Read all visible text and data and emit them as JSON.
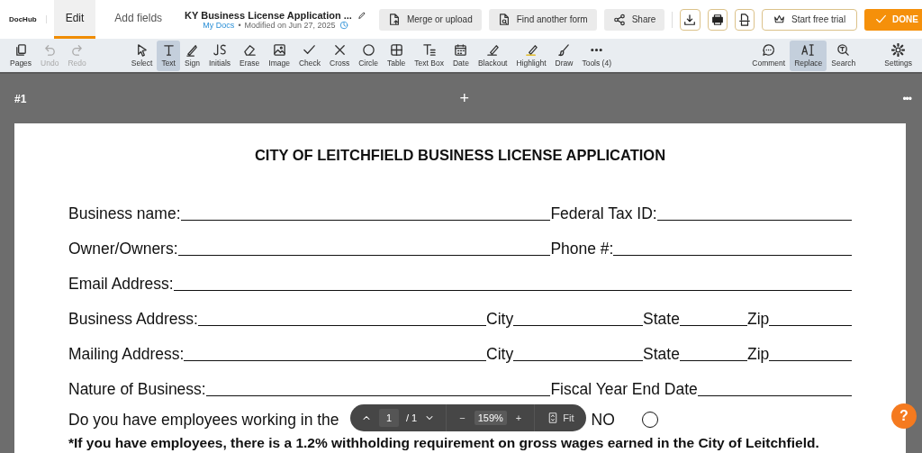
{
  "topbar": {
    "logo": "DocHub",
    "tabs": [
      {
        "label": "Edit",
        "selected": true
      },
      {
        "label": "Add fields",
        "selected": false
      }
    ],
    "document": {
      "title": "KY Business License Application ...",
      "location": "My Docs",
      "separator": "•",
      "modified": "Modified on Jun 27, 2025"
    },
    "buttons": [
      {
        "label": "Merge or upload"
      },
      {
        "label": "Find another form"
      },
      {
        "label": "Share"
      }
    ],
    "trial_button": "Start free trial",
    "done_button": "DONE"
  },
  "toolbar": {
    "groups": [
      [
        {
          "label": "Pages",
          "disabled": false,
          "selected": false
        },
        {
          "label": "Undo",
          "disabled": true,
          "selected": false
        },
        {
          "label": "Redo",
          "disabled": true,
          "selected": false
        }
      ],
      [
        {
          "label": "Select",
          "disabled": false,
          "selected": false
        },
        {
          "label": "Text",
          "disabled": false,
          "selected": true
        },
        {
          "label": "Sign",
          "disabled": false,
          "selected": false
        },
        {
          "label": "Initials",
          "disabled": false,
          "selected": false
        },
        {
          "label": "Erase",
          "disabled": false,
          "selected": false
        },
        {
          "label": "Image",
          "disabled": false,
          "selected": false
        },
        {
          "label": "Check",
          "disabled": false,
          "selected": false
        },
        {
          "label": "Cross",
          "disabled": false,
          "selected": false
        },
        {
          "label": "Circle",
          "disabled": false,
          "selected": false
        },
        {
          "label": "Table",
          "disabled": false,
          "selected": false
        },
        {
          "label": "Text Box",
          "disabled": false,
          "selected": false
        },
        {
          "label": "Date",
          "disabled": false,
          "selected": false
        },
        {
          "label": "Blackout",
          "disabled": false,
          "selected": false
        },
        {
          "label": "Highlight",
          "disabled": false,
          "selected": false
        },
        {
          "label": "Draw",
          "disabled": false,
          "selected": false
        },
        {
          "label": "Tools (4)",
          "disabled": false,
          "selected": false
        }
      ],
      [
        {
          "label": "Comment",
          "disabled": false,
          "selected": false
        },
        {
          "label": "Replace",
          "disabled": false,
          "selected": true
        },
        {
          "label": "Search",
          "disabled": false,
          "selected": false
        }
      ],
      [
        {
          "label": "Settings",
          "disabled": false,
          "selected": false
        }
      ]
    ]
  },
  "page_header": {
    "number": "#1",
    "add": "+",
    "more": "•••"
  },
  "form": {
    "title": "CITY OF LEITCHFIELD BUSINESS LICENSE APPLICATION",
    "rows": [
      {
        "fields": [
          "Business name:",
          "Federal Tax ID:"
        ]
      },
      {
        "fields": [
          "Owner/Owners:",
          "Phone #:"
        ]
      },
      {
        "fields": [
          "Email Address:"
        ]
      },
      {
        "fields": [
          "Business Address:",
          "City",
          "State",
          "Zip"
        ]
      },
      {
        "fields": [
          "Mailing Address:",
          "City",
          "State",
          "Zip"
        ]
      },
      {
        "fields": [
          "Nature of Business:",
          "Fiscal Year End Date"
        ]
      }
    ],
    "question": {
      "text": "Do you have employees working in the",
      "options": [
        {
          "label": "NO",
          "checked": false
        }
      ]
    },
    "note": "*If you have employees, there is a 1.2% withholding requirement on gross wages earned in the City of Leitchfield."
  },
  "zoom_bar": {
    "page": "1",
    "total": "/ 1",
    "zoom": "159%",
    "minus": "−",
    "plus": "+",
    "fit": "Fit"
  },
  "help": "?"
}
